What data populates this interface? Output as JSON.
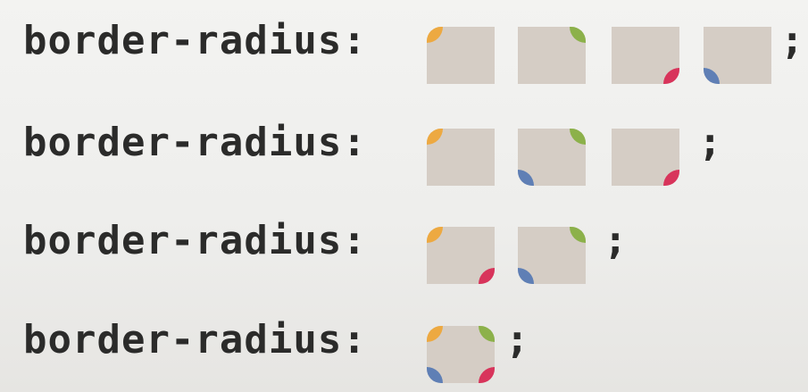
{
  "rows": [
    {
      "label": "border-radius:",
      "terminator": ";"
    },
    {
      "label": "border-radius:",
      "terminator": ";"
    },
    {
      "label": "border-radius:",
      "terminator": ";"
    },
    {
      "label": "border-radius:",
      "terminator": ";"
    }
  ],
  "colors": {
    "box": "#d5cdc5",
    "top_left": "#eda941",
    "top_right": "#8cb14a",
    "bottom_right": "#d8345b",
    "bottom_left": "#5f7fb5",
    "text": "#2b2b2a"
  }
}
